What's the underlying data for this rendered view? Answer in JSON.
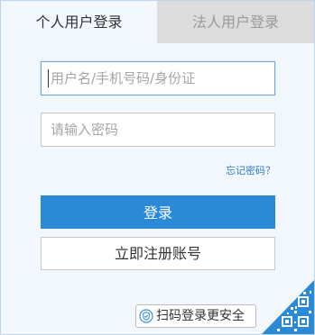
{
  "tabs": {
    "personal": "个人用户登录",
    "corporate": "法人用户登录"
  },
  "form": {
    "username_placeholder": "用户名/手机号码/身份证",
    "username_value": "",
    "password_placeholder": "请输入密码",
    "password_value": "",
    "forgot_label": "忘记密码？"
  },
  "buttons": {
    "login_label": "登录",
    "register_label": "立即注册账号"
  },
  "qr": {
    "login_label": "扫码登录更安全",
    "shield_icon": "shield-icon",
    "qr_icon": "qr-code-icon"
  },
  "colors": {
    "accent": "#2b8ad8",
    "link": "#2f7cc6",
    "panel_bg": "#f1f7fd",
    "inactive_tab_bg": "#dcdcdc"
  }
}
